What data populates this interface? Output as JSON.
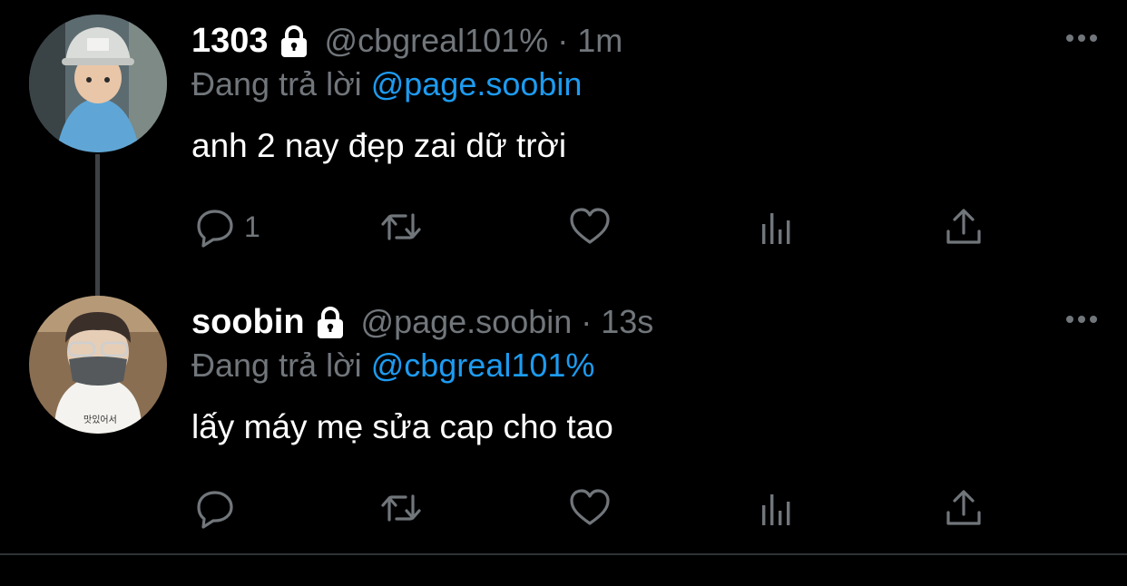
{
  "tweets": [
    {
      "name": "1303",
      "handle": "@cbgreal101%",
      "dot": "·",
      "time": "1m",
      "reply_prefix": "Đang trả lời",
      "reply_mention": "@page.soobin",
      "text": "anh 2 nay đẹp zai dữ trời",
      "reply_count": "1"
    },
    {
      "name": "soobin",
      "handle": "@page.soobin",
      "dot": "·",
      "time": "13s",
      "reply_prefix": "Đang trả lời",
      "reply_mention": "@cbgreal101%",
      "text": "lấy máy mẹ sửa cap cho tao",
      "reply_count": ""
    }
  ],
  "icons": {
    "lock": "lock-icon",
    "more": "more-icon",
    "reply": "reply-icon",
    "retweet": "retweet-icon",
    "like": "heart-icon",
    "stats": "stats-icon",
    "share": "share-icon"
  },
  "colors": {
    "background": "#000000",
    "text": "#ffffff",
    "muted": "#71767b",
    "link": "#1d9bf0",
    "thread_line": "#3e4144"
  }
}
